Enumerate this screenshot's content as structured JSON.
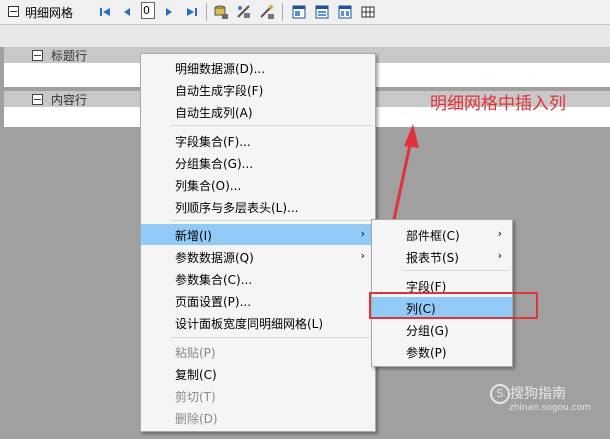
{
  "toolbar": {
    "title": "明细网格",
    "page_value": "0",
    "icons": [
      "first-page-icon",
      "prev-page-icon",
      "next-page-icon",
      "last-page-icon",
      "db-icon",
      "settings-icon",
      "wand-icon",
      "layout-icon-1",
      "layout-icon-2",
      "layout-icon-3",
      "layout-icon-4"
    ]
  },
  "bands": {
    "title_band": "标题行",
    "content_band": "内容行"
  },
  "annotation": "明细网格中插入列",
  "context_menu": {
    "items": [
      {
        "label": "明细数据源(D)...",
        "disabled": false
      },
      {
        "label": "自动生成字段(F)",
        "disabled": false
      },
      {
        "label": "自动生成列(A)",
        "disabled": false
      },
      {
        "label": "字段集合(F)...",
        "disabled": false
      },
      {
        "label": "分组集合(G)...",
        "disabled": false
      },
      {
        "label": "列集合(O)...",
        "disabled": false
      },
      {
        "label": "列顺序与多层表头(L)...",
        "disabled": false
      },
      {
        "label": "新增(I)",
        "disabled": false,
        "submenu": true,
        "highlighted": true
      },
      {
        "label": "参数数据源(Q)",
        "disabled": false,
        "submenu": true
      },
      {
        "label": "参数集合(C)...",
        "disabled": false
      },
      {
        "label": "页面设置(P)...",
        "disabled": false
      },
      {
        "label": "设计面板宽度同明细网格(L)",
        "disabled": false
      },
      {
        "label": "粘贴(P)",
        "disabled": true
      },
      {
        "label": "复制(C)",
        "disabled": false
      },
      {
        "label": "剪切(T)",
        "disabled": true
      },
      {
        "label": "删除(D)",
        "disabled": true
      }
    ]
  },
  "submenu": {
    "items": [
      {
        "label": "部件框(C)",
        "submenu": true
      },
      {
        "label": "报表节(S)",
        "submenu": true
      },
      {
        "label": "字段(F)"
      },
      {
        "label": "列(C)",
        "highlighted": true
      },
      {
        "label": "分组(G)"
      },
      {
        "label": "参数(P)"
      }
    ]
  },
  "watermark": {
    "brand": "搜狗指南",
    "url": "zhinan.sogou.com"
  },
  "colors": {
    "highlight": "#91c9f7",
    "annotation": "#e0323a"
  }
}
